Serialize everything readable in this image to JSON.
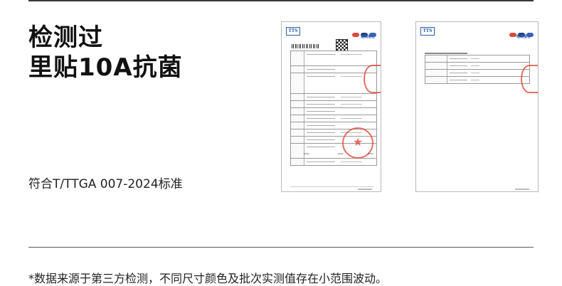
{
  "headline": {
    "line1": "检测过",
    "line2": "里贴10A抗菌"
  },
  "standard": "符合T/TTGA 007-2024标准",
  "footnote": "*数据来源于第三方检测，不同尺寸颜色及批次实测值存在小范围波动。",
  "reports": [
    {
      "logo": "TTS",
      "title": "检测报告"
    },
    {
      "logo": "TTS",
      "title": "检测报告"
    }
  ],
  "colors": {
    "rule": "#3a3a3a",
    "stamp": "#e04a3c",
    "report_title": "#2f5fae"
  }
}
